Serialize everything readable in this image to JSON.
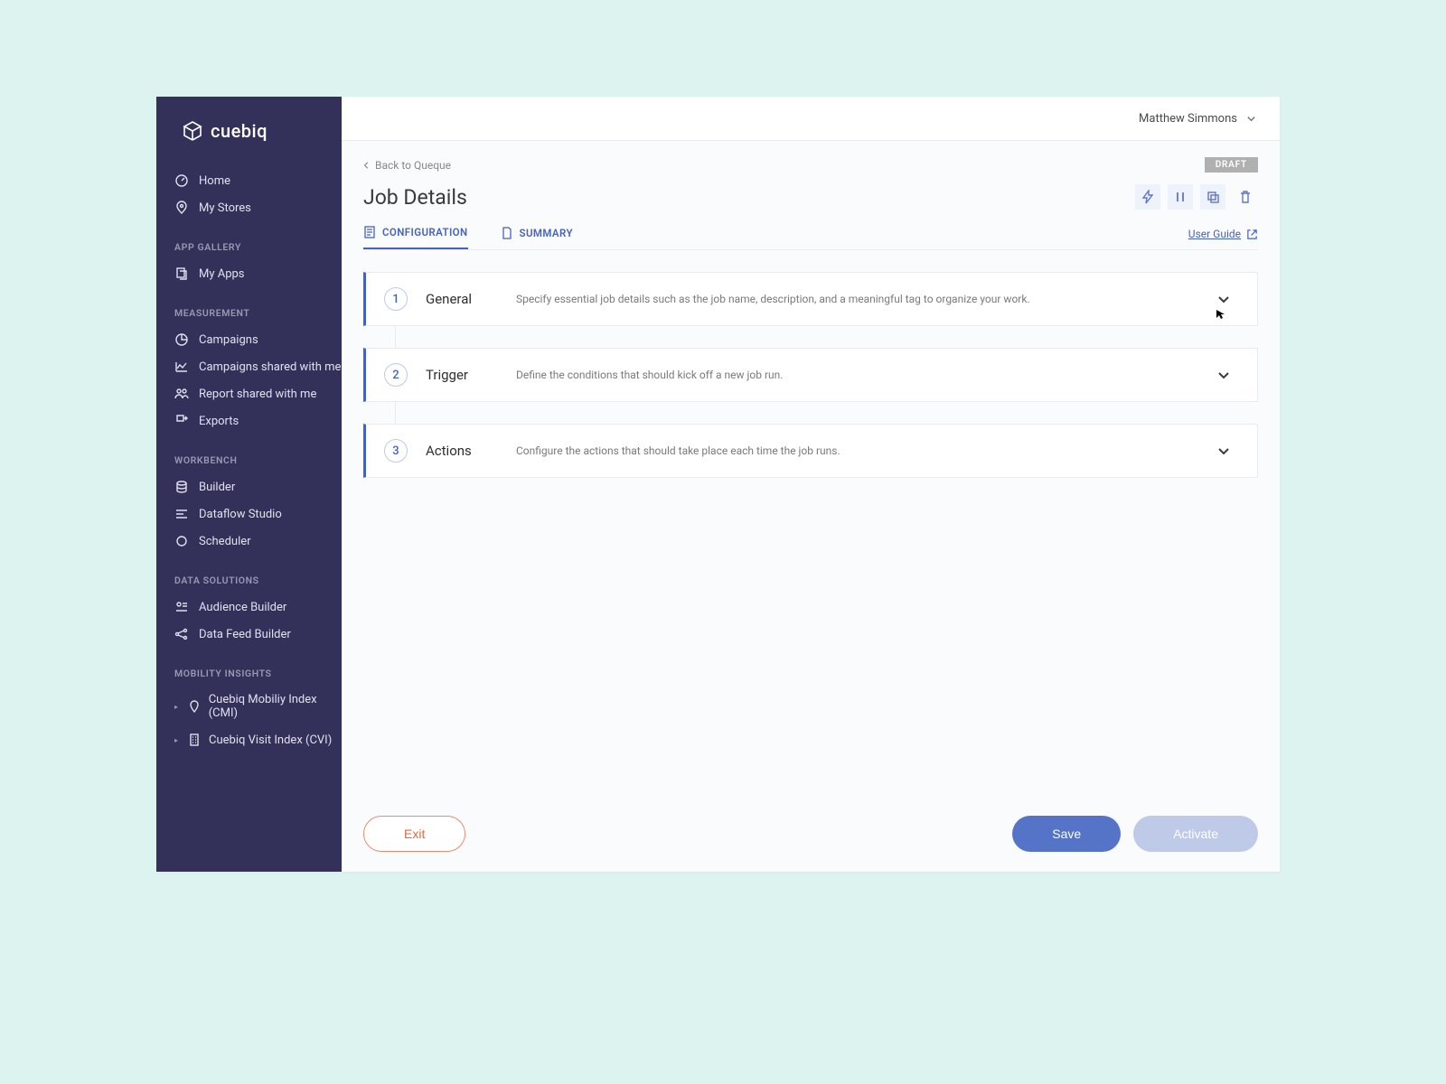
{
  "brand": {
    "name": "cuebiq"
  },
  "topbar": {
    "user": "Matthew Simmons"
  },
  "sidebar": {
    "top": [
      {
        "label": "Home",
        "icon": "gauge"
      },
      {
        "label": "My Stores",
        "icon": "pin"
      }
    ],
    "sections": [
      {
        "heading": "APP GALLERY",
        "items": [
          {
            "label": "My Apps",
            "icon": "copy"
          }
        ]
      },
      {
        "heading": "MEASUREMENT",
        "items": [
          {
            "label": "Campaigns",
            "icon": "pie"
          },
          {
            "label": "Campaigns shared with me",
            "icon": "chart"
          },
          {
            "label": "Report shared with me",
            "icon": "people"
          },
          {
            "label": "Exports",
            "icon": "export"
          }
        ]
      },
      {
        "heading": "WORKBENCH",
        "items": [
          {
            "label": "Builder",
            "icon": "db"
          },
          {
            "label": "Dataflow Studio",
            "icon": "lines"
          },
          {
            "label": "Scheduler",
            "icon": "circle"
          }
        ]
      },
      {
        "heading": "DATA SOLUTIONS",
        "items": [
          {
            "label": "Audience Builder",
            "icon": "audience"
          },
          {
            "label": "Data Feed Builder",
            "icon": "network"
          }
        ]
      },
      {
        "heading": "MOBILITY INSIGHTS",
        "items": [
          {
            "label": "Cuebiq Mobiliy Index (CMI)",
            "icon": "pin2",
            "chevron": true
          },
          {
            "label": "Cuebiq Visit Index (CVI)",
            "icon": "building",
            "chevron": true
          }
        ]
      }
    ]
  },
  "page": {
    "back": "Back to Queque",
    "title": "Job Details",
    "status": "DRAFT",
    "tabs": [
      {
        "label": "CONFIGURATION",
        "active": true
      },
      {
        "label": "SUMMARY",
        "active": false
      }
    ],
    "help": "User Guide",
    "steps": [
      {
        "n": "1",
        "title": "General",
        "desc": "Specify essential job details such as the job name, description, and a meaningful tag to organize your work."
      },
      {
        "n": "2",
        "title": "Trigger",
        "desc": "Define the conditions that should kick off a new job run."
      },
      {
        "n": "3",
        "title": "Actions",
        "desc": "Configure the actions that should take place each time the job runs."
      }
    ],
    "buttons": {
      "exit": "Exit",
      "save": "Save",
      "activate": "Activate"
    }
  }
}
